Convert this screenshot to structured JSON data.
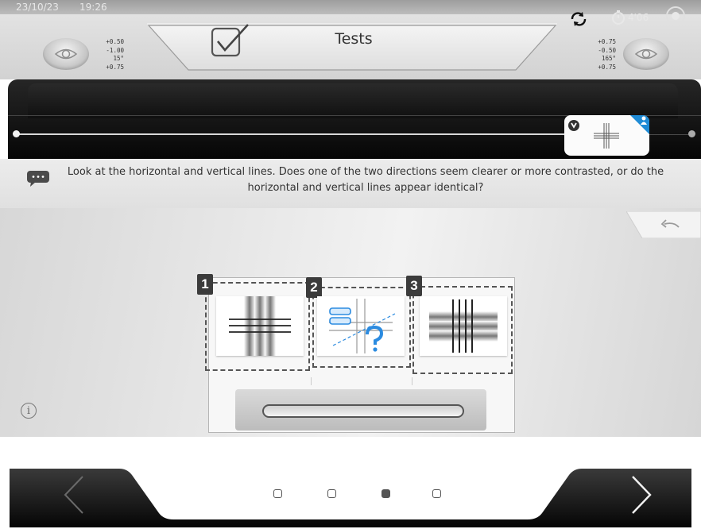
{
  "status": {
    "date": "23/10/23",
    "time": "19:26",
    "timer": "4'06"
  },
  "header": {
    "title": "Tests"
  },
  "prescription_left": [
    "+0.50",
    "-1.00",
    "15°",
    "+0.75"
  ],
  "prescription_right": [
    "+0.75",
    "-0.50",
    "165°",
    "+0.75"
  ],
  "instruction": "Look at the horizontal and vertical lines. Does one of the two directions seem clearer or more contrasted, or do the horizontal and vertical lines appear identical?",
  "choices": [
    {
      "number": "1",
      "icon": "vertical-blur-horizontal-sharp-icon"
    },
    {
      "number": "2",
      "icon": "identical-question-icon"
    },
    {
      "number": "3",
      "icon": "horizontal-blur-vertical-sharp-icon"
    }
  ],
  "info_label": "i",
  "pagination": {
    "total": 4,
    "active_index": 2
  },
  "colors": {
    "accent_blue": "#1f8bd5",
    "dark": "#111111"
  }
}
